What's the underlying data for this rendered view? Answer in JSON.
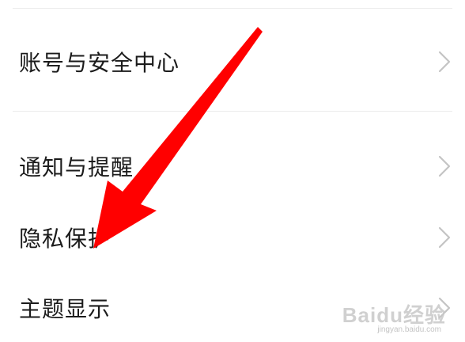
{
  "settings_list": {
    "items": [
      {
        "label": "账号与安全中心",
        "icon": "chevron-right-icon"
      },
      {
        "label": "通知与提醒",
        "icon": "chevron-right-icon"
      },
      {
        "label": "隐私保护",
        "icon": "chevron-right-icon"
      },
      {
        "label": "主题显示",
        "icon": "chevron-right-icon"
      }
    ]
  },
  "annotation": {
    "type": "red-arrow",
    "color": "#ff0000",
    "target": "隐私保护"
  },
  "watermark": {
    "logo": "Baidu经验",
    "sub": "jingyan.baidu.com"
  },
  "colors": {
    "text": "#1b1b1b",
    "chevron": "#c4c4c4",
    "divider": "#ececec",
    "background": "#ffffff"
  }
}
